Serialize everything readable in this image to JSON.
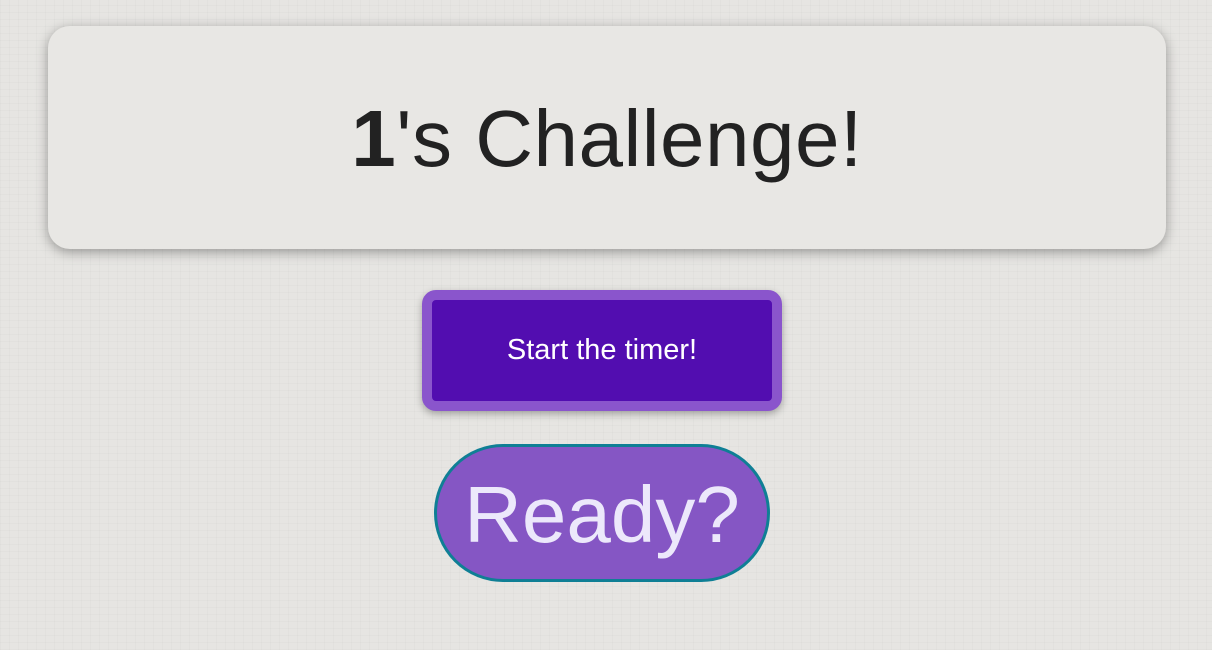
{
  "challenge": {
    "player": "1",
    "suffix": "'s Challenge!"
  },
  "start_button": {
    "label": "Start the timer!"
  },
  "ready_indicator": {
    "label": "Ready?"
  },
  "colors": {
    "background": "#e6e5e2",
    "card": "#e8e7e4",
    "start_button_fill": "#520db0",
    "start_button_border": "#8a55cc",
    "ready_fill": "#8556c4",
    "ready_border": "#0f7f95",
    "ready_text": "#ece8fb"
  }
}
